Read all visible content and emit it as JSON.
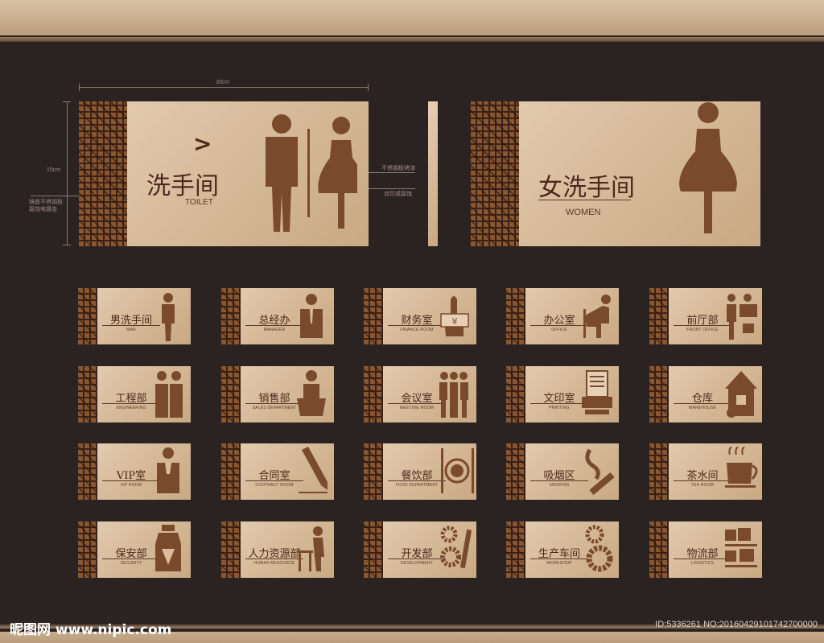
{
  "dimensions": {
    "width_label": "30cm",
    "height_label": "15cm"
  },
  "annotations": {
    "left": "镜面不锈钢板\n腐蚀电镀金",
    "right_top": "不锈钢板烤漆",
    "right_bottom": "丝印或腐蚀"
  },
  "main_signs": [
    {
      "cn": "洗手间",
      "en": "TOILET",
      "arrow": ">"
    },
    {
      "cn": "女洗手间",
      "en": "WOMEN"
    }
  ],
  "small_signs": [
    {
      "cn": "男洗手间",
      "en": "MAN",
      "icon": "man-icon"
    },
    {
      "cn": "总经办",
      "en": "MANAGER",
      "icon": "manager-icon"
    },
    {
      "cn": "财务室",
      "en": "FINANCE ROOM",
      "icon": "finance-icon"
    },
    {
      "cn": "办公室",
      "en": "OFFICE",
      "icon": "office-icon"
    },
    {
      "cn": "前厅部",
      "en": "FRONT OFFICE",
      "icon": "front-office-icon"
    },
    {
      "cn": "工程部",
      "en": "ENGINEERING",
      "icon": "engineering-icon"
    },
    {
      "cn": "销售部",
      "en": "SALES DEPARTMENT",
      "icon": "sales-icon"
    },
    {
      "cn": "会议室",
      "en": "MEETING ROOM",
      "icon": "meeting-icon"
    },
    {
      "cn": "文印室",
      "en": "PRINTING",
      "icon": "printer-icon"
    },
    {
      "cn": "仓库",
      "en": "WAREHOUSE",
      "icon": "warehouse-icon"
    },
    {
      "cn": "VIP室",
      "en": "VIP ROOM",
      "icon": "vip-icon"
    },
    {
      "cn": "合同室",
      "en": "CONTRACT ROOM",
      "icon": "pencil-icon"
    },
    {
      "cn": "餐饮部",
      "en": "FOOD DEPARTMENT",
      "icon": "dining-icon"
    },
    {
      "cn": "吸烟区",
      "en": "SMOKING",
      "icon": "smoking-icon"
    },
    {
      "cn": "茶水间",
      "en": "TEA ROOM",
      "icon": "tea-cup-icon"
    },
    {
      "cn": "保安部",
      "en": "SECURITY",
      "icon": "security-icon"
    },
    {
      "cn": "人力资源部",
      "en": "HUMAN RESOURCE",
      "icon": "hr-icon"
    },
    {
      "cn": "开发部",
      "en": "DEVELOPMENT",
      "icon": "gears-wrench-icon"
    },
    {
      "cn": "生产车间",
      "en": "WORKSHOP",
      "icon": "gears-icon"
    },
    {
      "cn": "物流部",
      "en": "LOGISTICS",
      "icon": "logistics-icon"
    }
  ],
  "watermark": {
    "left": "昵图网 www.nipic.com",
    "right": "ID:5336261 NO:20160429101742700000"
  },
  "colors": {
    "background": "#2b2322",
    "plate": "#d8bc9c",
    "lattice": "#8a5630",
    "ink": "#4a2a1c",
    "figure": "#7a4a2c"
  }
}
